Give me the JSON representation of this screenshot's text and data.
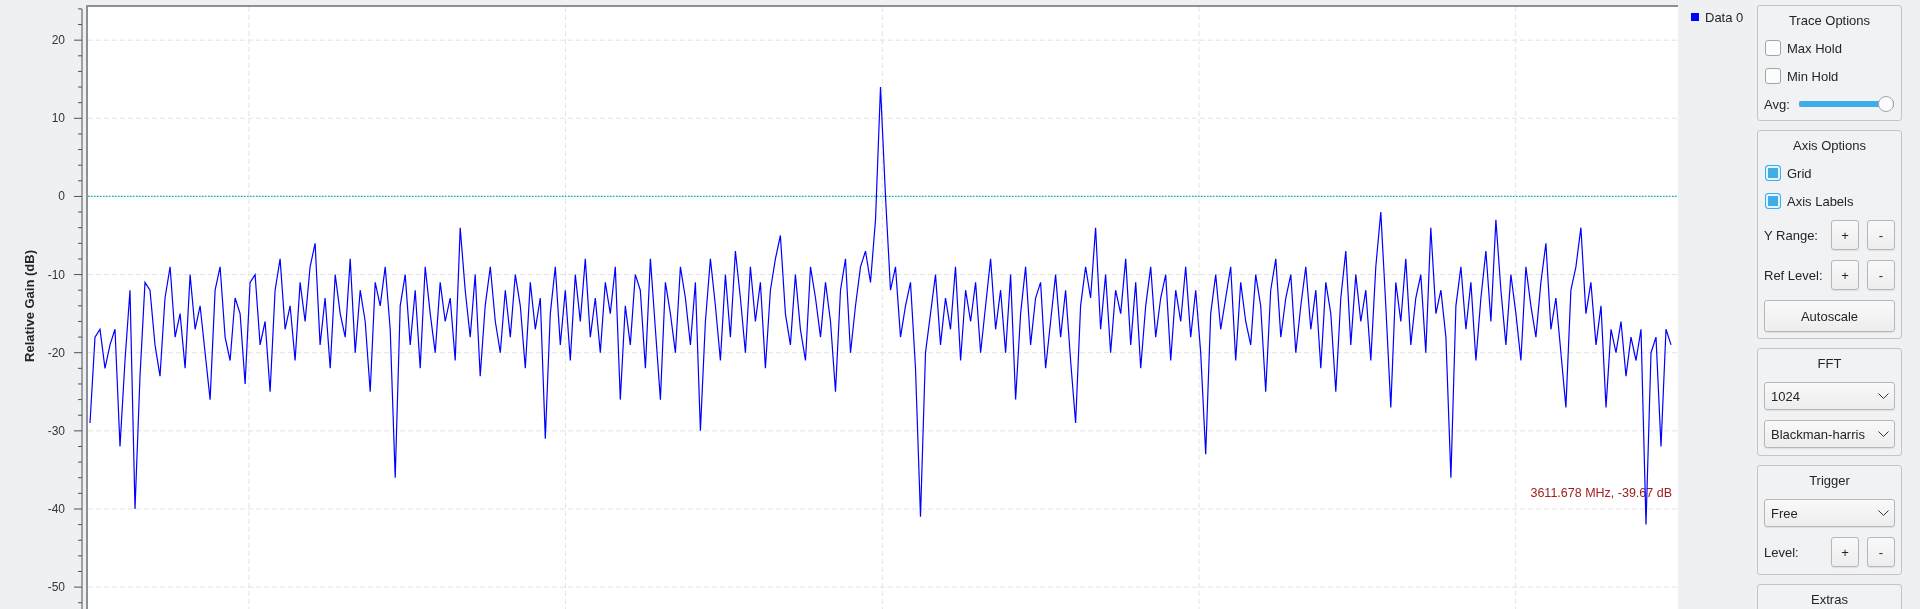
{
  "plot": {
    "chart_data": {
      "type": "line",
      "ylabel": "Relative Gain (dB)",
      "ylim": [
        -52.8,
        24.5
      ],
      "yticks": [
        20,
        10,
        0,
        -10,
        -20,
        -30,
        -40,
        -50
      ],
      "grid": true,
      "ref_lines": [
        {
          "axis": "y",
          "value": 0
        }
      ],
      "series": [
        {
          "name": "Data 0",
          "color": "#0000ff",
          "values": [
            -29,
            -18,
            -17,
            -22,
            -19,
            -17,
            -32,
            -21,
            -12,
            -40,
            -23,
            -11,
            -12,
            -19,
            -23,
            -13,
            -9,
            -18,
            -15,
            -22,
            -10,
            -17,
            -14,
            -20,
            -26,
            -12,
            -9,
            -18,
            -21,
            -13,
            -15,
            -24,
            -11,
            -10,
            -19,
            -16,
            -25,
            -12,
            -8,
            -17,
            -14,
            -21,
            -11,
            -16,
            -9,
            -6,
            -19,
            -13,
            -22,
            -10,
            -15,
            -18,
            -8,
            -20,
            -12,
            -16,
            -25,
            -11,
            -14,
            -9,
            -17,
            -36,
            -14,
            -10,
            -19,
            -12,
            -22,
            -9,
            -15,
            -20,
            -11,
            -16,
            -13,
            -21,
            -4,
            -12,
            -18,
            -10,
            -23,
            -14,
            -9,
            -16,
            -20,
            -12,
            -18,
            -10,
            -14,
            -22,
            -11,
            -17,
            -13,
            -31,
            -15,
            -9,
            -19,
            -12,
            -21,
            -10,
            -16,
            -8,
            -18,
            -13,
            -20,
            -11,
            -15,
            -9,
            -26,
            -14,
            -19,
            -10,
            -12,
            -22,
            -8,
            -17,
            -26,
            -11,
            -15,
            -20,
            -9,
            -13,
            -19,
            -11,
            -30,
            -16,
            -8,
            -14,
            -21,
            -10,
            -18,
            -7,
            -13,
            -20,
            -9,
            -16,
            -11,
            -22,
            -12,
            -8,
            -5,
            -15,
            -19,
            -10,
            -17,
            -21,
            -9,
            -13,
            -18,
            -11,
            -16,
            -25,
            -12,
            -8,
            -20,
            -14,
            -9,
            -7,
            -11,
            -3,
            14,
            0,
            -12,
            -9,
            -18,
            -14,
            -11,
            -22,
            -41,
            -20,
            -15,
            -10,
            -19,
            -13,
            -17,
            -9,
            -21,
            -12,
            -16,
            -11,
            -20,
            -14,
            -8,
            -17,
            -12,
            -20,
            -10,
            -26,
            -15,
            -9,
            -19,
            -13,
            -11,
            -22,
            -16,
            -10,
            -18,
            -12,
            -21,
            -29,
            -14,
            -9,
            -13,
            -4,
            -17,
            -10,
            -20,
            -12,
            -15,
            -8,
            -19,
            -11,
            -22,
            -14,
            -9,
            -18,
            -13,
            -10,
            -21,
            -12,
            -16,
            -9,
            -18,
            -12,
            -20,
            -33,
            -15,
            -10,
            -17,
            -13,
            -9,
            -21,
            -11,
            -16,
            -19,
            -10,
            -14,
            -25,
            -12,
            -8,
            -18,
            -13,
            -10,
            -20,
            -14,
            -9,
            -17,
            -12,
            -22,
            -11,
            -15,
            -25,
            -13,
            -7,
            -19,
            -10,
            -16,
            -12,
            -21,
            -9,
            -2,
            -14,
            -27,
            -11,
            -16,
            -8,
            -19,
            -13,
            -10,
            -20,
            -4,
            -15,
            -12,
            -18,
            -36,
            -14,
            -9,
            -17,
            -11,
            -21,
            -13,
            -7,
            -16,
            -3,
            -12,
            -19,
            -10,
            -15,
            -21,
            -9,
            -14,
            -18,
            -11,
            -6,
            -17,
            -13,
            -20,
            -27,
            -12,
            -9,
            -4,
            -15,
            -11,
            -19,
            -14,
            -27,
            -17,
            -20,
            -16,
            -23,
            -18,
            -21,
            -17,
            -42,
            -20,
            -18,
            -32,
            -17,
            -19
          ]
        }
      ]
    },
    "marker_readout": "3611.678 MHz, -39.67 dB"
  },
  "panel": {
    "groups": [
      {
        "title": "Trace Options",
        "items": [
          {
            "kind": "checkbox",
            "label": "Max Hold",
            "checked": false
          },
          {
            "kind": "checkbox",
            "label": "Min Hold",
            "checked": false
          },
          {
            "kind": "slider",
            "label": "Avg:",
            "level": 1
          }
        ]
      },
      {
        "title": "Axis Options",
        "items": [
          {
            "kind": "checkbox",
            "label": "Grid",
            "checked": true
          },
          {
            "kind": "checkbox",
            "label": "Axis Labels",
            "checked": true
          },
          {
            "kind": "stepper",
            "label": "Y Range:",
            "buttons": [
              "+",
              "-"
            ]
          },
          {
            "kind": "stepper",
            "label": "Ref Level:",
            "buttons": [
              "+",
              "-"
            ]
          },
          {
            "kind": "button",
            "label": "Autoscale"
          }
        ]
      },
      {
        "title": "FFT",
        "items": [
          {
            "kind": "dropdown",
            "value": "1024"
          },
          {
            "kind": "dropdown",
            "value": "Blackman-harris"
          }
        ]
      },
      {
        "title": "Trigger",
        "items": [
          {
            "kind": "dropdown",
            "value": "Free"
          },
          {
            "kind": "stepper",
            "label": "Level:",
            "buttons": [
              "+",
              "-"
            ]
          }
        ]
      },
      {
        "title": "Extras"
      }
    ]
  }
}
